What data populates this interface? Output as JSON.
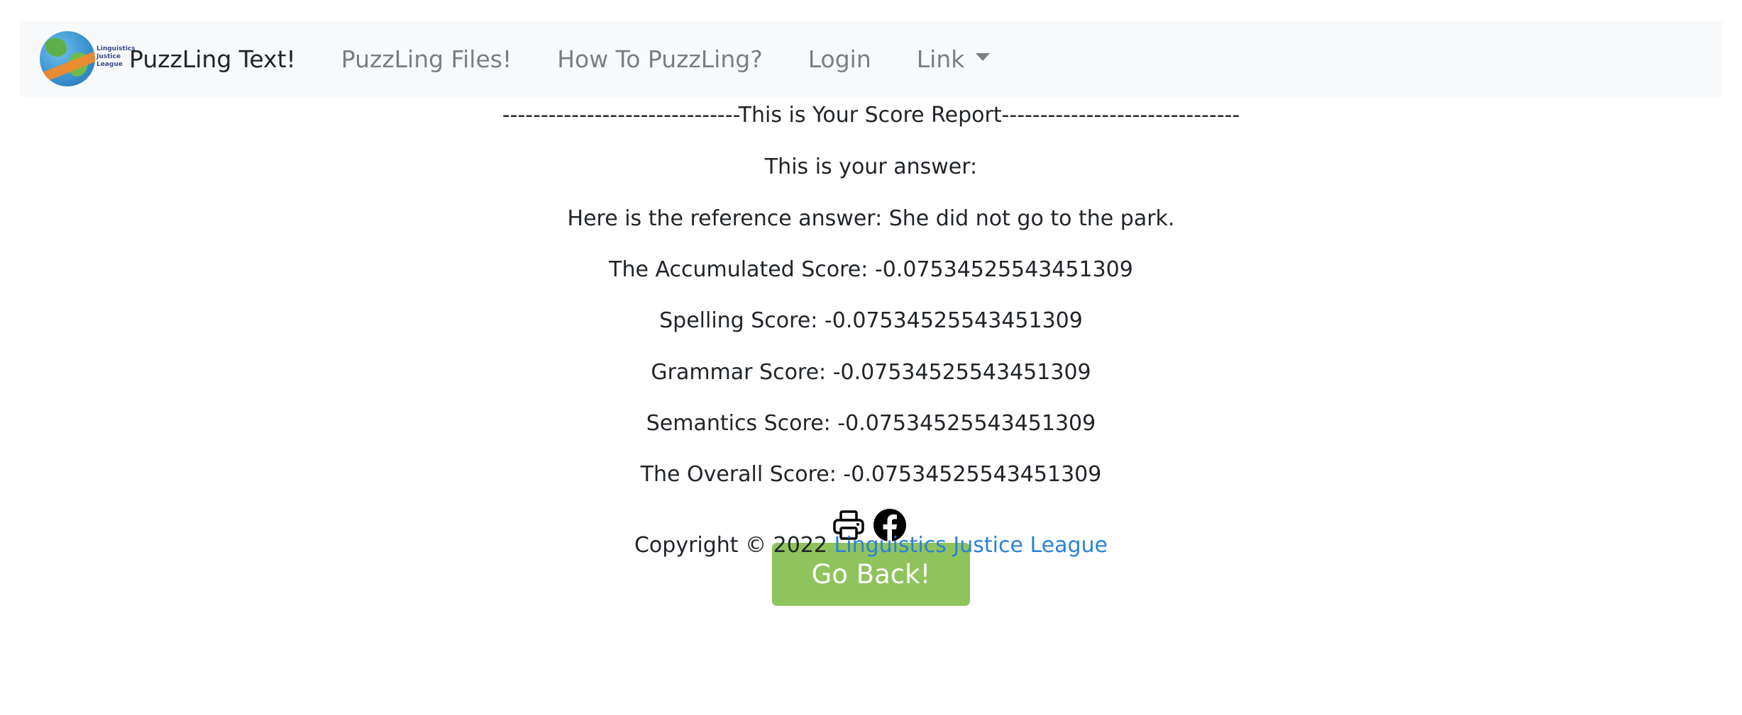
{
  "navbar": {
    "logo_text": [
      "Linguistics",
      "Justice",
      "League"
    ],
    "brand": "PuzzLing Text!",
    "links": [
      {
        "label": "PuzzLing Files!"
      },
      {
        "label": "How To PuzzLing?"
      },
      {
        "label": "Login"
      },
      {
        "label": "Link",
        "dropdown": true
      }
    ]
  },
  "report": {
    "header": "-------------------------------This is Your Score Report-------------------------------",
    "your_answer": "This is your answer:",
    "reference_answer": "Here is the reference answer: She did not go to the park.",
    "accumulated_score": "The Accumulated Score: -0.07534525543451309",
    "spelling_score": "Spelling Score: -0.07534525543451309",
    "grammar_score": "Grammar Score: -0.07534525543451309",
    "semantics_score": "Semantics Score: -0.07534525543451309",
    "overall_score": "The Overall Score: -0.07534525543451309"
  },
  "share": {
    "icons": [
      "printer-icon",
      "facebook-icon"
    ]
  },
  "go_back_label": "Go Back!",
  "footer": {
    "copyright": "Copyright © 2022 ",
    "link_text": "Linguistics Justice League"
  },
  "colors": {
    "navbar_bg": "#f8f9fa",
    "button_green": "#8fc35c",
    "link_blue": "#2b82d6"
  }
}
